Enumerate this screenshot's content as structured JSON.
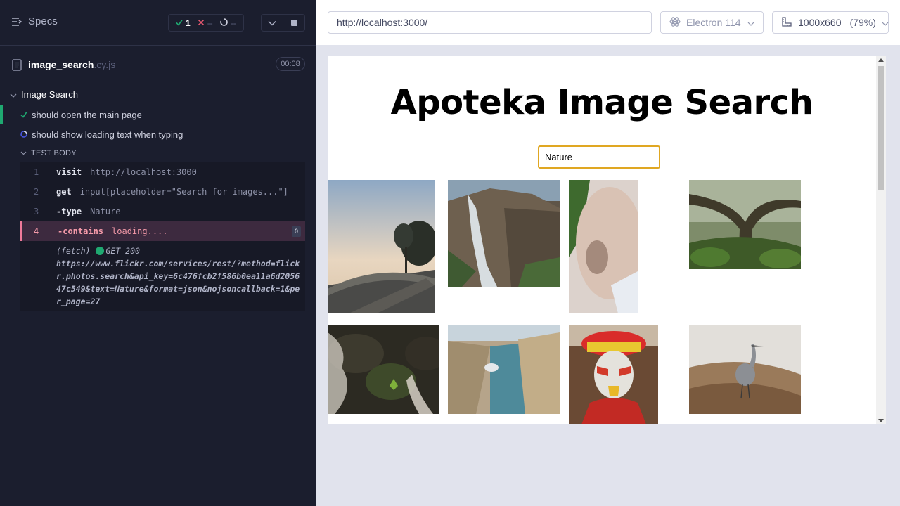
{
  "reporter": {
    "specs_label": "Specs",
    "stats": {
      "passed": "1",
      "failed": "--",
      "pending": "--"
    },
    "spec_file": {
      "name": "image_search",
      "ext": ".cy.js",
      "duration": "00:08"
    },
    "suite_title": "Image Search",
    "tests": [
      {
        "title": "should open the main page",
        "state": "passed"
      },
      {
        "title": "should show loading text when typing",
        "state": "running"
      }
    ],
    "test_body_label": "TEST BODY",
    "commands": [
      {
        "num": "1",
        "name": "visit",
        "message": "http://localhost:3000"
      },
      {
        "num": "2",
        "name": "get",
        "message": "input[placeholder=\"Search for images...\"]"
      },
      {
        "num": "3",
        "name": "-type",
        "message": "Nature"
      },
      {
        "num": "4",
        "name": "-contains",
        "message": "loading....",
        "badge": "0"
      }
    ],
    "fetch_log": {
      "label": "(fetch)",
      "status": "GET 200",
      "url": "https://www.flickr.com/services/rest/?method=flickr.photos.search&api_key=6c476fcb2f586b0ea11a6d205647c549&text=Nature&format=json&nojsoncallback=1&per_page=27"
    }
  },
  "aut": {
    "url": "http://localhost:3000/",
    "browser": "Electron 114",
    "viewport": "1000x660",
    "zoom": "(79%)",
    "app": {
      "title": "Apoteka Image Search",
      "search_value": "Nature",
      "search_placeholder": "Search for images..."
    },
    "photos": [
      "boardwalk-sunset",
      "waterfall-cliff",
      "skin-closeup",
      "mossy-forest-tree",
      "stream-rocks-fern",
      "coastal-canyon",
      "tribal-face-paint",
      "heron-wetland"
    ]
  },
  "colors": {
    "reporter_bg": "#1b1e2e",
    "pass_green": "#1fa971",
    "fail_red": "#e45770",
    "active_cmd_bg": "#3d2a3f",
    "input_border": "#e0a722"
  }
}
